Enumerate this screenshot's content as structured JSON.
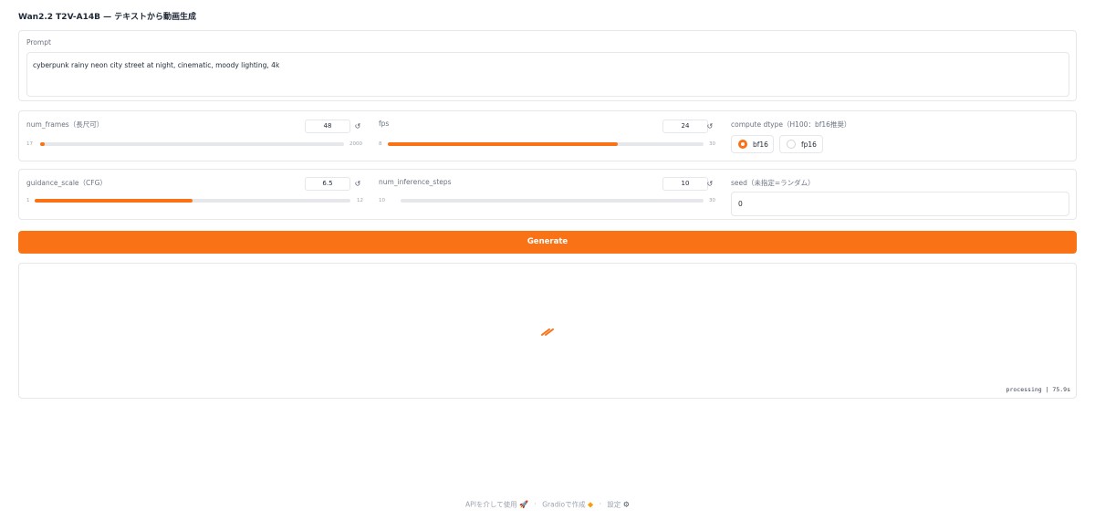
{
  "app": {
    "title": "Wan2.2 T2V-A14B — テキストから動画生成"
  },
  "prompt": {
    "label": "Prompt",
    "value": "cyberpunk rainy neon city street at night, cinematic, moody lighting, 4k"
  },
  "num_frames": {
    "label": "num_frames（長尺可）",
    "value": "48",
    "min": "17",
    "max": "2000",
    "fill_fraction": 0.016
  },
  "fps": {
    "label": "fps",
    "value": "24",
    "min": "8",
    "max": "30",
    "fill_fraction": 0.727
  },
  "compute_dtype": {
    "label": "compute dtype（H100：bf16推奨）",
    "options": [
      "bf16",
      "fp16"
    ],
    "selected": "bf16"
  },
  "guidance_scale": {
    "label": "guidance_scale（CFG）",
    "value": "6.5",
    "min": "1",
    "max": "12",
    "fill_fraction": 0.5
  },
  "num_inference_steps": {
    "label": "num_inference_steps",
    "value": "10",
    "min": "10",
    "max": "30",
    "fill_fraction": 0.0
  },
  "seed": {
    "label": "seed（未指定=ランダム）",
    "value": "0"
  },
  "generate": {
    "label": "Generate"
  },
  "output": {
    "status": "processing | 75.9s"
  },
  "footer": {
    "api": "APIを介して使用",
    "gradio": "Gradioで作成",
    "settings": "設定",
    "separator": "·"
  },
  "colors": {
    "accent": "#f97316",
    "border": "#e5e7eb",
    "muted_text": "#6b7280"
  },
  "icons": {
    "reset": "reset-icon",
    "api": "rocket-icon",
    "gradio": "gradio-logo-icon",
    "settings": "gear-icon",
    "loading": "loading-spinner-icon"
  }
}
